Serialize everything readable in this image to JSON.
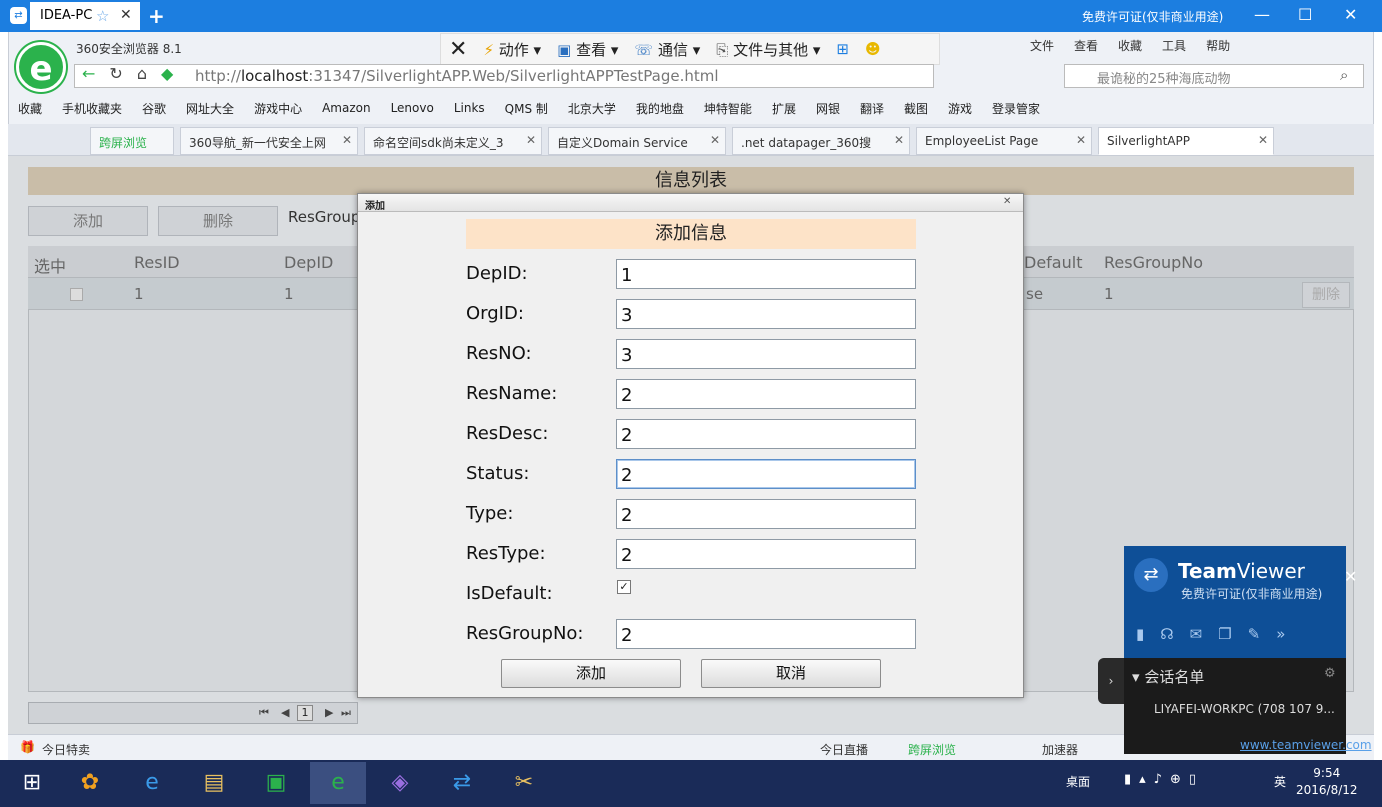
{
  "remote": {
    "tab_label": "IDEA-PC",
    "license": "免费许可证(仅非商业用途)",
    "window_controls": [
      "—",
      "☐",
      "✕"
    ]
  },
  "browser": {
    "name": "360安全浏览器 8.1",
    "toolbar": [
      "动作",
      "查看",
      "通信",
      "文件与其他"
    ],
    "menu": [
      "文件",
      "查看",
      "收藏",
      "工具",
      "帮助"
    ],
    "url_prefix": "http://",
    "url_host": "localhost",
    "url_rest": ":31347/SilverlightAPP.Web/SilverlightAPPTestPage.html",
    "search_placeholder": "最诡秘的25种海底动物",
    "favorites": [
      "收藏",
      "手机收藏夹",
      "谷歌",
      "网址大全",
      "游戏中心",
      "Amazon",
      "Lenovo",
      "Links",
      "QMS 制",
      "北京大学",
      "我的地盘",
      "坤特智能"
    ],
    "extras": [
      "扩展",
      "网银",
      "翻译",
      "截图",
      "游戏",
      "登录管家"
    ],
    "tabs": [
      "跨屏浏览",
      "360导航_新一代安全上网",
      "命名空间sdk尚未定义_3",
      "自定义Domain Service",
      ".net datapager_360搜",
      "EmployeeList Page",
      "SilverlightAPP"
    ],
    "status_left": "今日特卖",
    "status_right": [
      "今日直播",
      "跨屏浏览",
      "加速器"
    ]
  },
  "page": {
    "title": "信息列表",
    "add_button": "添加",
    "delete_button": "删除",
    "resgroup_label": "ResGroup",
    "grid_headers": [
      "选中",
      "ResID",
      "DepID",
      "Default",
      "ResGroupNo"
    ],
    "grid_row": {
      "resid": "1",
      "depid": "1",
      "default_tail": "se",
      "resgroupno": "1",
      "delete": "删除"
    },
    "pager_page": "1"
  },
  "dialog": {
    "window_title": "添加",
    "header": "添加信息",
    "fields": [
      {
        "label": "DepID:",
        "value": "1"
      },
      {
        "label": "OrgID:",
        "value": "3"
      },
      {
        "label": "ResNO:",
        "value": "3"
      },
      {
        "label": "ResName:",
        "value": "2"
      },
      {
        "label": "ResDesc:",
        "value": "2"
      },
      {
        "label": "Status:",
        "value": "2"
      },
      {
        "label": "Type:",
        "value": "2"
      },
      {
        "label": "ResType:",
        "value": "2"
      },
      {
        "label": "IsDefault:",
        "value": "✓"
      },
      {
        "label": "ResGroupNo:",
        "value": "2"
      }
    ],
    "ok_button": "添加",
    "cancel_button": "取消"
  },
  "teamviewer": {
    "brand_bold": "Team",
    "brand_light": "Viewer",
    "license": "免费许可证(仅非商业用途)",
    "session_title": "会话名单",
    "session_item": "LIYAFEI-WORKPC (708 107 9...",
    "link": "www.teamviewer.com"
  },
  "taskbar": {
    "desktop": "桌面",
    "ime": "英",
    "time": "9:54",
    "date": "2016/8/12"
  }
}
